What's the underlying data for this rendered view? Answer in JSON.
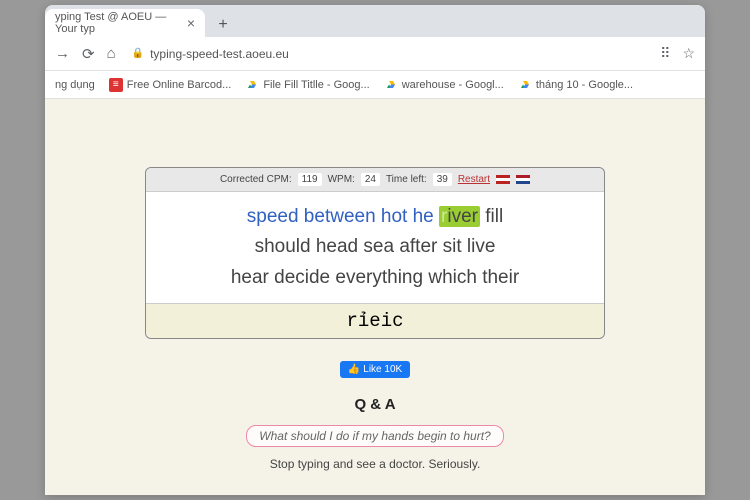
{
  "browser": {
    "tab_title": "yping Test @ AOEU — Your typ",
    "url": "typing-speed-test.aoeu.eu",
    "bookmarks_label": "ng dụng",
    "bookmarks": [
      {
        "label": "Free Online Barcod...",
        "icon": "red"
      },
      {
        "label": "File Fill Titlle - Goog...",
        "icon": "drive"
      },
      {
        "label": "warehouse - Googl...",
        "icon": "drive"
      },
      {
        "label": "tháng 10 - Google...",
        "icon": "drive"
      }
    ]
  },
  "stats": {
    "cpm_label": "Corrected CPM:",
    "cpm": "119",
    "wpm_label": "WPM:",
    "wpm": "24",
    "time_label": "Time left:",
    "time": "39",
    "restart": "Restart"
  },
  "words": {
    "l1_before": "speed between hot he ",
    "current_typed": "r",
    "current_rest": "iver",
    "l1_after": " fill",
    "l2": "should head sea after sit live",
    "l3": "hear decide everything which their"
  },
  "input": {
    "value": "rỉeic"
  },
  "like": {
    "label": "Like 10K"
  },
  "qa": {
    "title": "Q & A",
    "q": "What should I do if my hands begin to hurt?",
    "a": "Stop typing and see a doctor. Seriously."
  }
}
